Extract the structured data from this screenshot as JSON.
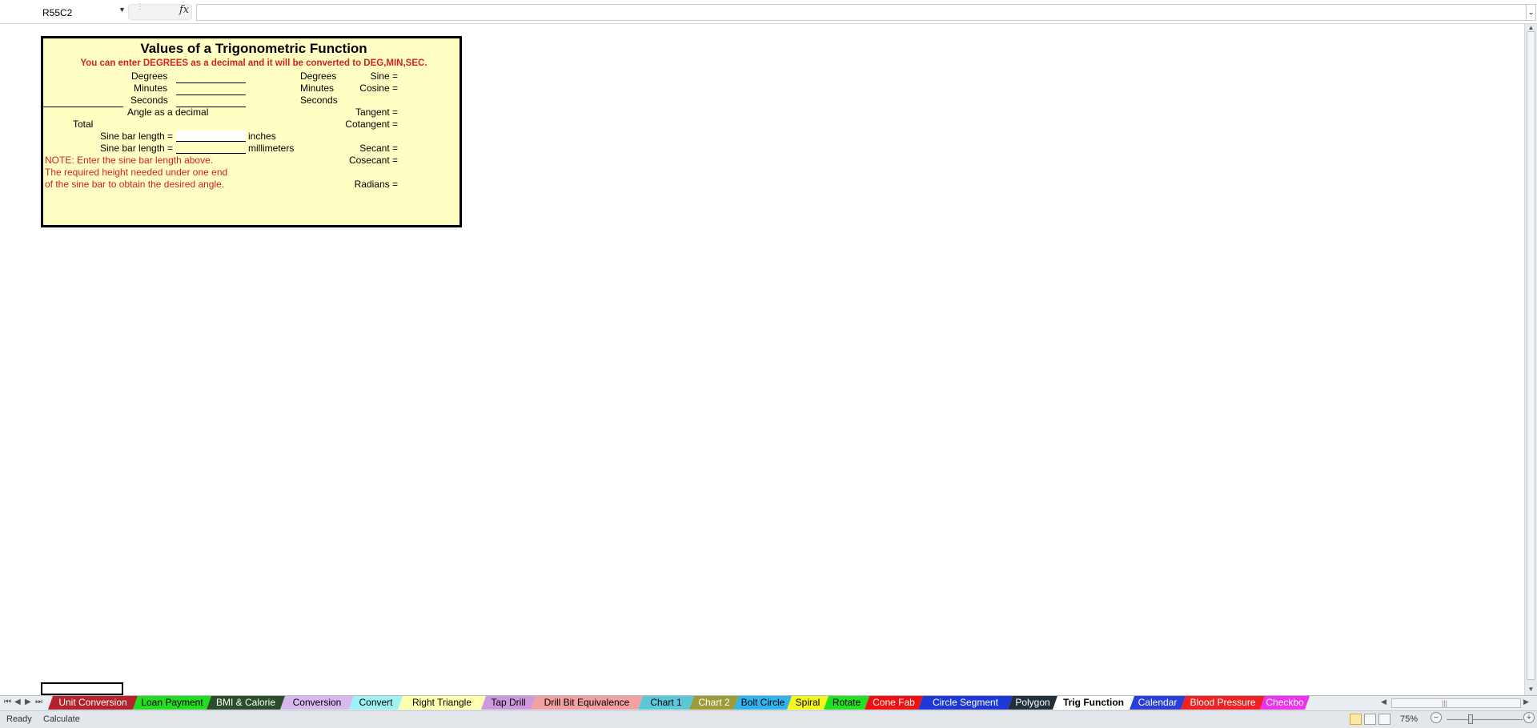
{
  "formula_bar": {
    "name_box": "R55C2",
    "fx": "fx",
    "formula": ""
  },
  "panel": {
    "title": "Values of a Trigonometric Function",
    "subtitle": "You can enter DEGREES as a decimal and it will be converted to DEG,MIN,SEC.",
    "left_labels": {
      "degrees": "Degrees",
      "minutes": "Minutes",
      "seconds": "Seconds"
    },
    "mid_labels": {
      "degrees": "Degrees",
      "minutes": "Minutes",
      "seconds": "Seconds"
    },
    "angle_decimal": "Angle as a decimal",
    "total": "Total",
    "sine_bar_label": "Sine bar length =",
    "inches": "inches",
    "millimeters": "millimeters",
    "note": [
      "NOTE: Enter the sine bar length above.",
      "The required height needed under one end",
      "of the sine bar to obtain the desired angle."
    ],
    "functions": {
      "sine": "Sine =",
      "cosine": "Cosine =",
      "tangent": "Tangent =",
      "cotangent": "Cotangent =",
      "secant": "Secant =",
      "cosecant": "Cosecant =",
      "radians": "Radians ="
    }
  },
  "tabs": [
    {
      "label": "Unit Conversion",
      "color": "#b5222b",
      "text_color": "#ffffff"
    },
    {
      "label": "Loan Payment",
      "color": "#22dd22",
      "text_color": "#000000"
    },
    {
      "label": "BMI & Calorie",
      "color": "#2a4d2a",
      "text_color": "#ffffff"
    },
    {
      "label": "Conversion",
      "color": "#d9b8f0",
      "text_color": "#000000"
    },
    {
      "label": "Convert",
      "color": "#9ff2f4",
      "text_color": "#000000"
    },
    {
      "label": "Right Triangle",
      "color": "#ffffb0",
      "text_color": "#000000"
    },
    {
      "label": "Tap Drill",
      "color": "#cc99dd",
      "text_color": "#000000"
    },
    {
      "label": "Drill Bit Equivalence",
      "color": "#f2a0a0",
      "text_color": "#000000"
    },
    {
      "label": "Chart 1",
      "color": "#5ac8d6",
      "text_color": "#000000"
    },
    {
      "label": "Chart 2",
      "color": "#9c9c3a",
      "text_color": "#ffffff"
    },
    {
      "label": "Bolt Circle",
      "color": "#2fb4f0",
      "text_color": "#000000"
    },
    {
      "label": "Spiral",
      "color": "#f5f520",
      "text_color": "#000000"
    },
    {
      "label": "Rotate",
      "color": "#22e022",
      "text_color": "#000000"
    },
    {
      "label": "Cone Fab",
      "color": "#ee1111",
      "text_color": "#ffffff"
    },
    {
      "label": "Circle Segment",
      "color": "#1e38d6",
      "text_color": "#ffffff"
    },
    {
      "label": "Polygon",
      "color": "#23303a",
      "text_color": "#ffffff"
    },
    {
      "label": "Trig Function",
      "color": "#ffffff",
      "text_color": "#000000",
      "active": true
    },
    {
      "label": "Calendar",
      "color": "#2a3fd8",
      "text_color": "#ffffff"
    },
    {
      "label": "Blood Pressure",
      "color": "#ee2222",
      "text_color": "#ffffff"
    },
    {
      "label": "Checkbo",
      "color": "#ee33ee",
      "text_color": "#ffffff"
    }
  ],
  "status_bar": {
    "ready": "Ready",
    "calculate": "Calculate",
    "zoom": "75%"
  }
}
